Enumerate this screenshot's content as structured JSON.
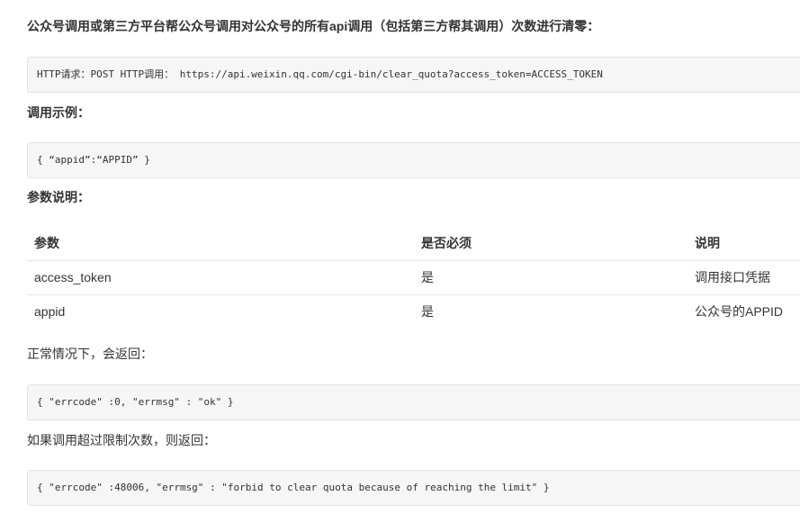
{
  "doc": {
    "intro_heading": "公众号调用或第三方平台帮公众号调用对公众号的所有api调用（包括第三方帮其调用）次数进行清零：",
    "request_line": "HTTP请求：POST HTTP调用： https://api.weixin.qq.com/cgi-bin/clear_quota?access_token=ACCESS_TOKEN",
    "example_heading": "调用示例：",
    "example_code": "{ “appid”:“APPID” }",
    "params_heading": "参数说明：",
    "table": {
      "headers": [
        "参数",
        "是否必须",
        "说明"
      ],
      "rows": [
        [
          "access_token",
          "是",
          "调用接口凭据"
        ],
        [
          "appid",
          "是",
          "公众号的APPID"
        ]
      ]
    },
    "normal_text": "正常情况下，会返回：",
    "normal_code": "{ \"errcode\" :0, \"errmsg\" : \"ok\" }",
    "limit_text": "如果调用超过限制次数，则返回：",
    "limit_code": "{ \"errcode\" :48006, \"errmsg\" : \"forbid to clear quota because of reaching the limit\" }"
  }
}
